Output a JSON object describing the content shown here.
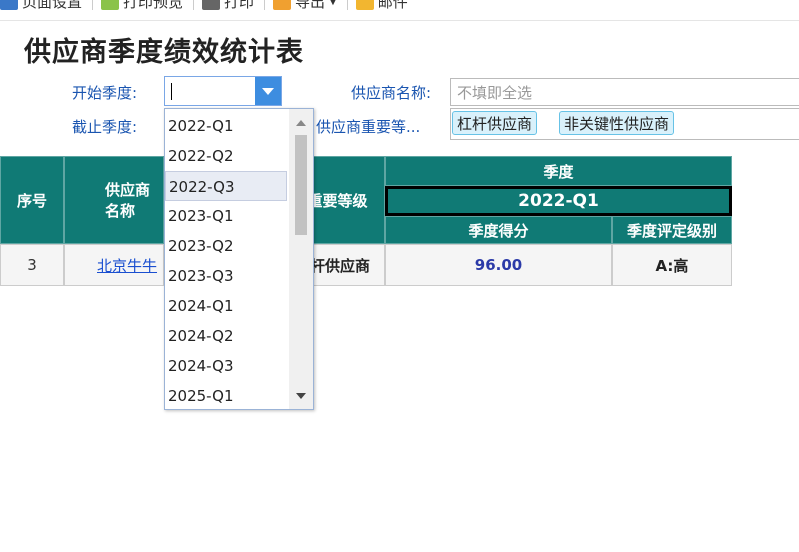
{
  "toolbar": {
    "items": [
      {
        "label": "页面设置",
        "icon": "page-setup-icon"
      },
      {
        "label": "打印预览",
        "icon": "print-preview-icon"
      },
      {
        "label": "打印",
        "icon": "printer-icon"
      },
      {
        "label": "导出",
        "icon": "export-icon"
      },
      {
        "label": "邮件",
        "icon": "mail-icon"
      }
    ]
  },
  "page_title": "供应商季度绩效统计表",
  "filters": {
    "start_label": "开始季度:",
    "end_label": "截止季度:",
    "supplier_name_label": "供应商名称:",
    "supplier_name_placeholder": "不填即全选",
    "importance_label": "供应商重要等...",
    "importance_tags": [
      "杠杆供应商",
      "非关键性供应商"
    ]
  },
  "dropdown": {
    "options": [
      "2022-Q1",
      "2022-Q2",
      "2022-Q3",
      "2023-Q1",
      "2023-Q2",
      "2023-Q3",
      "2024-Q1",
      "2024-Q2",
      "2024-Q3",
      "2025-Q1"
    ],
    "highlighted": "2022-Q3"
  },
  "table": {
    "headers": {
      "seq": "序号",
      "supplier": "供应商名称",
      "level": "重要等级",
      "quarter_group": "季度",
      "quarter": "2022-Q1",
      "score": "季度得分",
      "grade": "季度评定级别"
    },
    "rows": [
      {
        "seq": "3",
        "supplier": "北京牛牛",
        "level": "杠杆供应商",
        "score": "96.00",
        "grade": "A:高"
      }
    ]
  },
  "colors": {
    "header_bg": "#107a75",
    "accent": "#3d8de0",
    "link": "#1a4fd0"
  }
}
